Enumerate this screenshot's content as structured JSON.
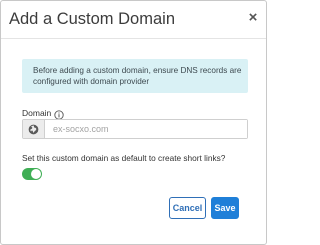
{
  "dialog": {
    "title": "Add a Custom Domain",
    "close_label": "×"
  },
  "info_message": {
    "line1": "Before adding a custom domain, ensure DNS records are",
    "line2": "configured with domain provider"
  },
  "domain_field": {
    "label": "Domain",
    "placeholder": "ex-socxo.com",
    "value": "",
    "addon_icon": "globe-icon",
    "help_icon": "info-icon"
  },
  "default_option": {
    "question": "Set this custom domain as default to create short links?",
    "toggle_on": true
  },
  "buttons": {
    "cancel_label": "Cancel",
    "save_label": "Save"
  },
  "colors": {
    "info_bg": "#d9f1f5",
    "toggle_on": "#3fae55",
    "primary": "#1f7fd8",
    "cancel_text": "#2f6fb7"
  }
}
